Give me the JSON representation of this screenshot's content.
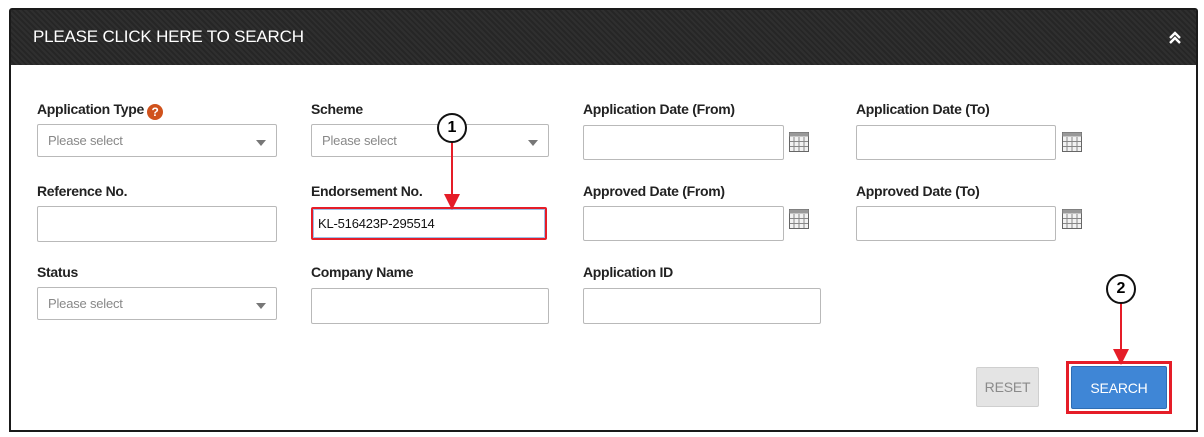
{
  "header": {
    "title": "PLEASE CLICK HERE TO SEARCH"
  },
  "fields": {
    "application_type": {
      "label": "Application Type",
      "value": "Please select"
    },
    "scheme": {
      "label": "Scheme",
      "value": "Please select"
    },
    "application_date_from": {
      "label": "Application Date (From)",
      "value": ""
    },
    "application_date_to": {
      "label": "Application Date (To)",
      "value": ""
    },
    "reference_no": {
      "label": "Reference No.",
      "value": ""
    },
    "endorsement_no": {
      "label": "Endorsement No.",
      "value": "KL-516423P-295514"
    },
    "approved_date_from": {
      "label": "Approved Date (From)",
      "value": ""
    },
    "approved_date_to": {
      "label": "Approved Date (To)",
      "value": ""
    },
    "status": {
      "label": "Status",
      "value": "Please select"
    },
    "company_name": {
      "label": "Company Name",
      "value": ""
    },
    "application_id": {
      "label": "Application ID",
      "value": ""
    }
  },
  "buttons": {
    "reset": "RESET",
    "search": "SEARCH"
  },
  "callouts": {
    "one": "1",
    "two": "2"
  },
  "colors": {
    "highlight": "#e51d28",
    "search_button": "#3f86d6",
    "help_icon": "#d0521c"
  }
}
